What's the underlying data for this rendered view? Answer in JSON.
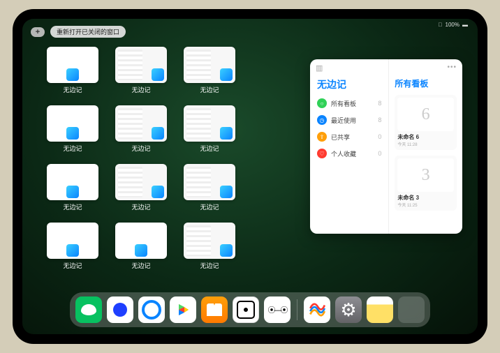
{
  "status": {
    "battery": "100%",
    "wifi": "􀙇"
  },
  "topbar": {
    "plus": "+",
    "reopen_label": "重新打开已关闭的窗口"
  },
  "window_label": "无边记",
  "windows": [
    {
      "style": "blank"
    },
    {
      "style": "detail"
    },
    {
      "style": "detail"
    },
    null,
    {
      "style": "blank"
    },
    {
      "style": "detail"
    },
    {
      "style": "detail"
    },
    null,
    {
      "style": "blank"
    },
    {
      "style": "detail"
    },
    {
      "style": "detail"
    },
    null,
    {
      "style": "blank"
    },
    {
      "style": "blank"
    },
    {
      "style": "detail"
    }
  ],
  "panel": {
    "left_title": "无边记",
    "right_title": "所有看板",
    "categories": [
      {
        "icon": "○",
        "color": "#30d158",
        "label": "所有看板",
        "count": "8"
      },
      {
        "icon": "◷",
        "color": "#0a84ff",
        "label": "最近使用",
        "count": "8"
      },
      {
        "icon": "⇪",
        "color": "#ff9f0a",
        "label": "已共享",
        "count": "0"
      },
      {
        "icon": "♡",
        "color": "#ff3b30",
        "label": "个人收藏",
        "count": "0"
      }
    ],
    "boards": [
      {
        "sketch": "6",
        "title": "未命名 6",
        "sub": "今天 11:28"
      },
      {
        "sketch": "3",
        "title": "未命名 3",
        "sub": "今天 11:25"
      }
    ]
  },
  "dock": {
    "apps": [
      {
        "name": "wechat"
      },
      {
        "name": "quark"
      },
      {
        "name": "qqbrowser"
      },
      {
        "name": "play"
      },
      {
        "name": "books"
      },
      {
        "name": "dice"
      },
      {
        "name": "connect"
      }
    ],
    "recent": [
      {
        "name": "freeform"
      },
      {
        "name": "settings"
      },
      {
        "name": "notes"
      },
      {
        "name": "app-library"
      }
    ]
  }
}
